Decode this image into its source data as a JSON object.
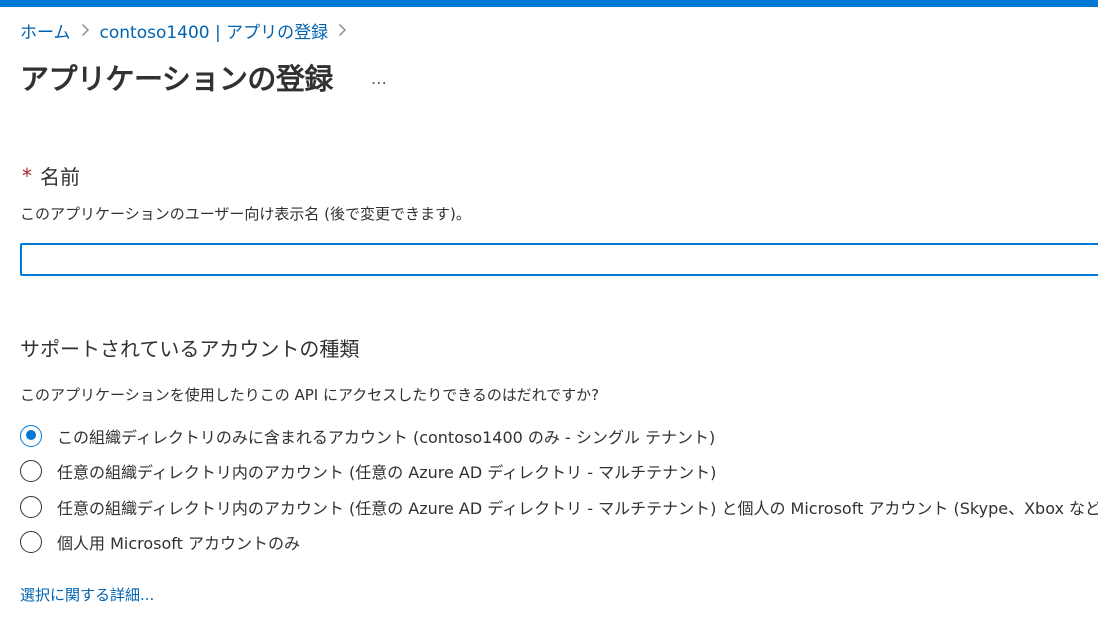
{
  "accent_color": "#0078d4",
  "breadcrumb": {
    "items": [
      {
        "label": "ホーム"
      },
      {
        "label": "contoso1400 | アプリの登録"
      }
    ],
    "separator_icon": "chevron-right-icon"
  },
  "page": {
    "title": "アプリケーションの登録",
    "more_label": "…"
  },
  "name_field": {
    "required_marker": "*",
    "label": "名前",
    "description": "このアプリケーションのユーザー向け表示名 (後で変更できます)。",
    "value": "",
    "placeholder": ""
  },
  "account_types": {
    "title": "サポートされているアカウントの種類",
    "question": "このアプリケーションを使用したりこの API にアクセスしたりできるのはだれですか?",
    "options": [
      {
        "label": "この組織ディレクトリのみに含まれるアカウント (contoso1400 のみ - シングル テナント)",
        "selected": true
      },
      {
        "label": "任意の組織ディレクトリ内のアカウント (任意の Azure AD ディレクトリ - マルチテナント)",
        "selected": false
      },
      {
        "label": "任意の組織ディレクトリ内のアカウント (任意の Azure AD ディレクトリ - マルチテナント) と個人の Microsoft アカウント (Skype、Xbox など)",
        "selected": false
      },
      {
        "label": "個人用 Microsoft アカウントのみ",
        "selected": false
      }
    ],
    "help_link": "選択に関する詳細..."
  }
}
